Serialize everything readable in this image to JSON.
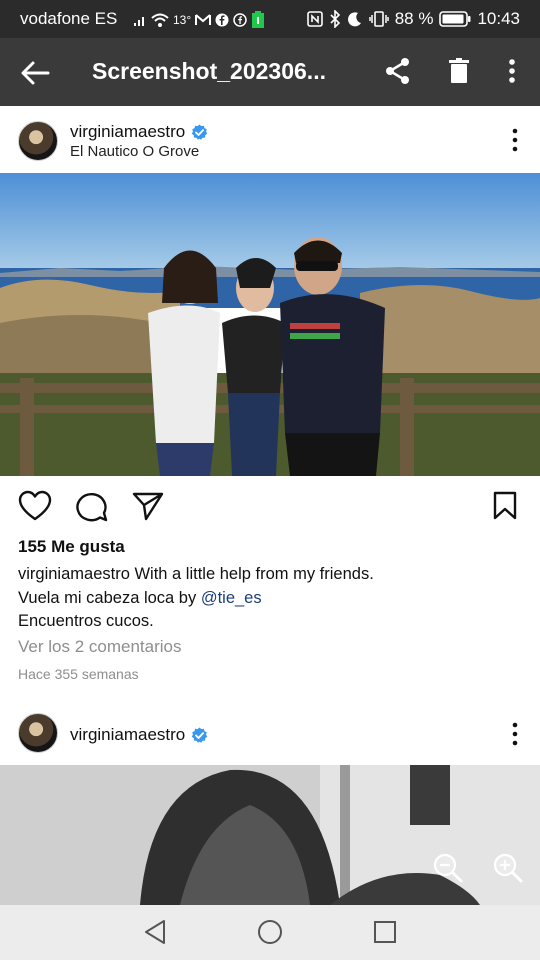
{
  "status_bar": {
    "carrier": "vodafone ES",
    "temperature": "13°",
    "battery": "88 %",
    "time": "10:43"
  },
  "app_bar": {
    "title": "Screenshot_202306..."
  },
  "post1": {
    "username": "virginiamaestro",
    "location": "El Nautico O Grove",
    "likes": "155 Me gusta",
    "caption_user": "virginiamaestro",
    "caption_text_1": " With a little help from my friends.",
    "caption_text_2": "Vuela mi cabeza loca by ",
    "mention": "@tie_es",
    "caption_text_3": "Encuentros cucos.",
    "comments_link": "Ver los 2 comentarios",
    "timestamp": "Hace 355 semanas"
  },
  "post2": {
    "username": "virginiamaestro"
  },
  "colors": {
    "status_bg": "#2b2b2b",
    "appbar_bg": "#3a3a3a",
    "verified_blue": "#3897f0",
    "mention_blue": "#1c3e7a",
    "muted_text": "#8e8e8e",
    "navbar_bg": "#ececec"
  },
  "icons": {
    "back": "arrow-left-icon",
    "share": "share-icon",
    "delete": "trash-icon",
    "menu": "more-vert-icon",
    "like": "heart-icon",
    "comment": "comment-bubble-icon",
    "send": "send-icon",
    "save": "bookmark-icon",
    "zoom_out": "zoom-out-icon",
    "zoom_in": "zoom-in-icon"
  }
}
